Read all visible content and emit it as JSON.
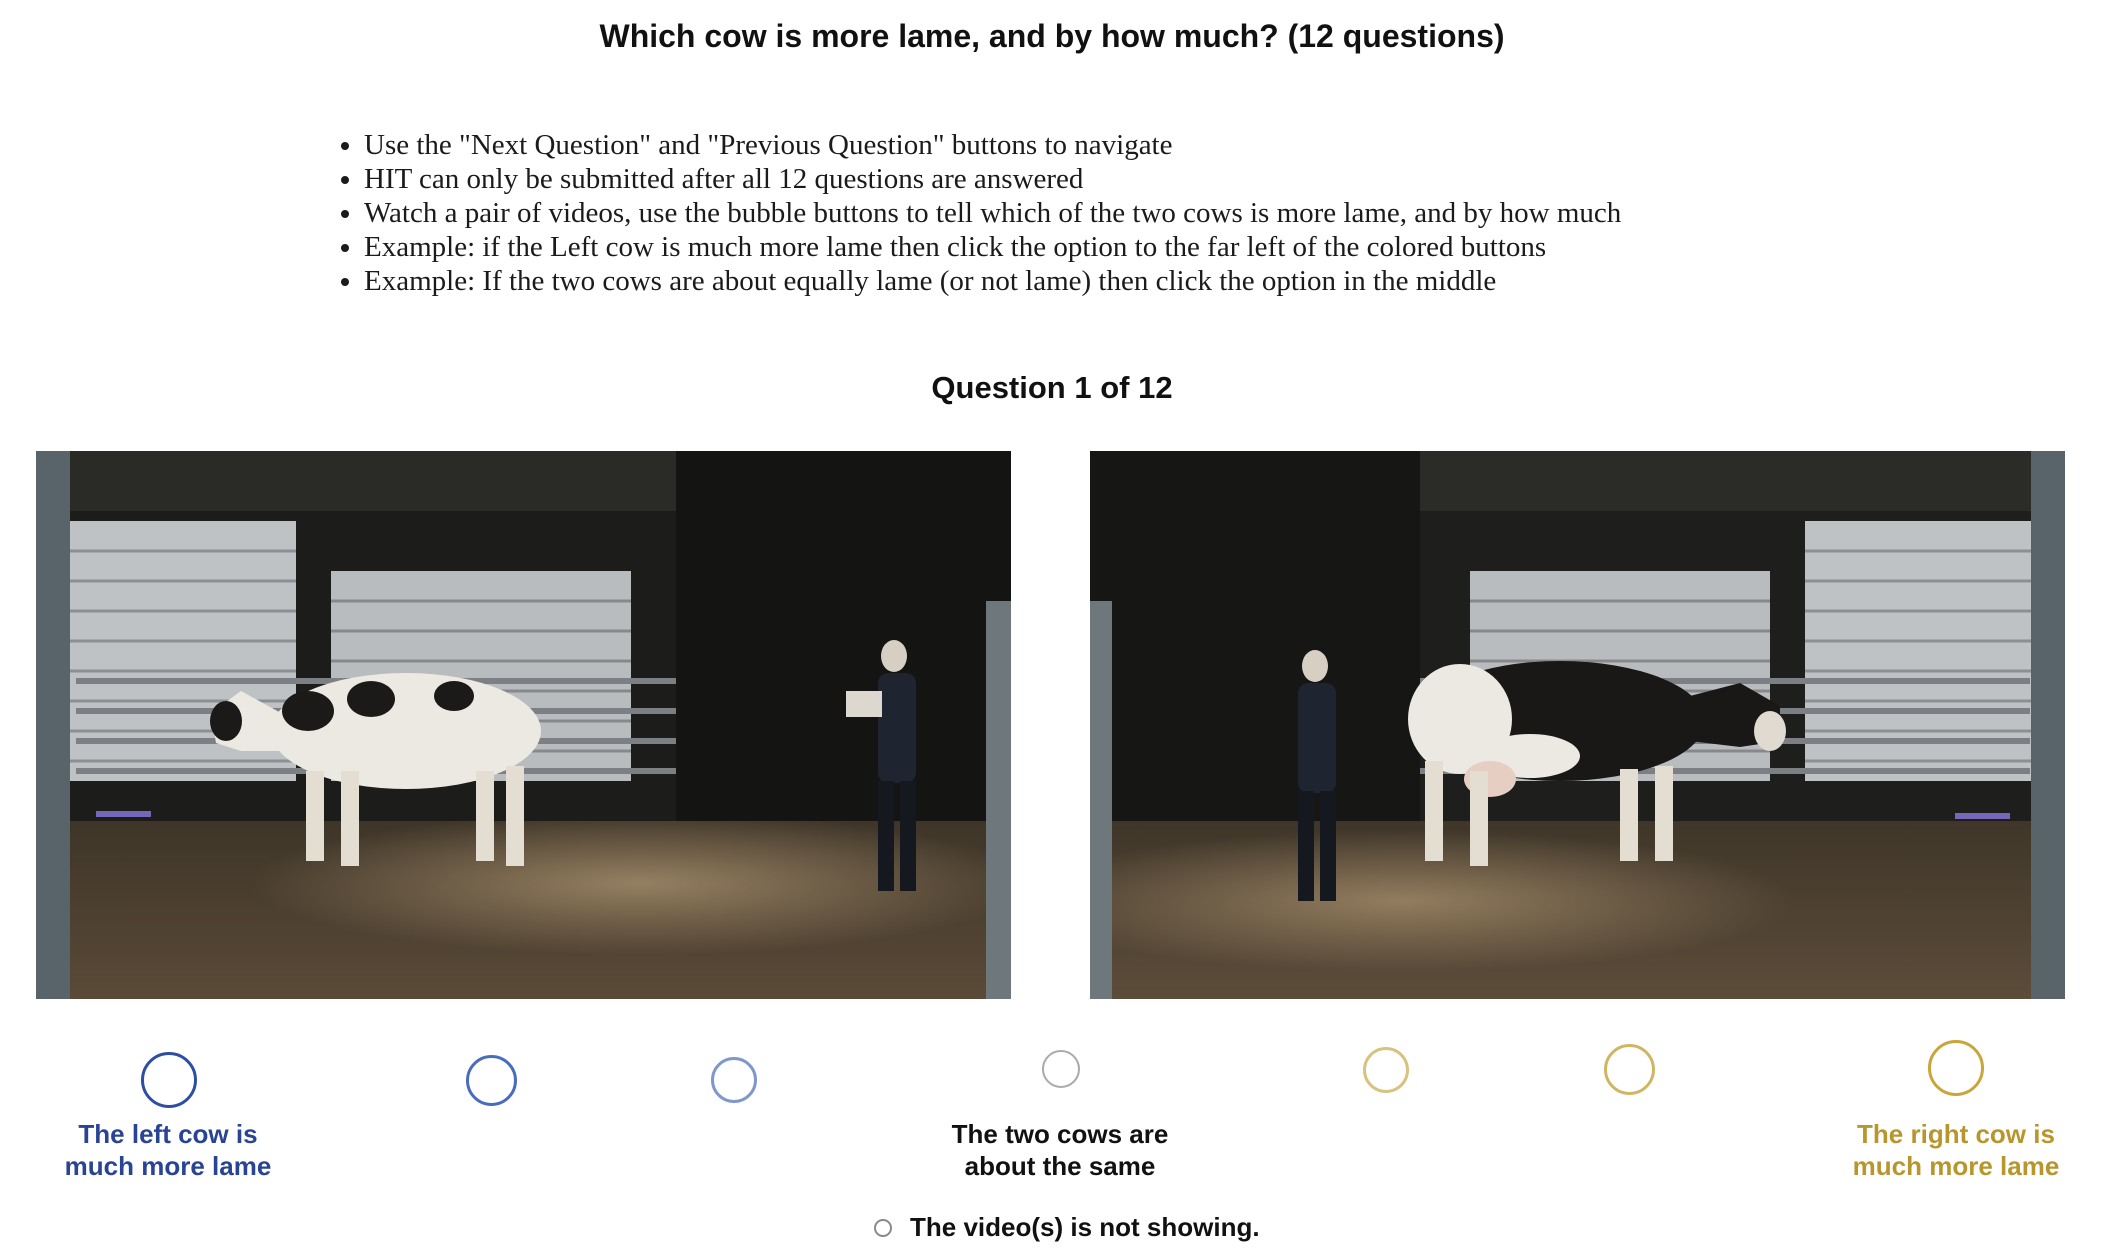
{
  "title": "Which cow is more lame, and by how much? (12 questions)",
  "instructions": [
    "Use the \"Next Question\" and \"Previous Question\" buttons to navigate",
    "HIT can only be submitted after all 12 questions are answered",
    "Watch a pair of videos, use the bubble buttons to tell which of the two cows is more lame, and by how much",
    "Example: if the Left cow is much more lame then click the option to the far left of the colored buttons",
    "Example: If the two cows are about equally lame (or not lame) then click the option in the middle"
  ],
  "question": {
    "heading": "Question 1 of 12",
    "current": 1,
    "total": 12
  },
  "scale": {
    "left_label": [
      "The left cow is",
      "much more lame"
    ],
    "middle_label": [
      "The two cows are",
      "about the same"
    ],
    "right_label": [
      "The right cow is",
      "much more lame"
    ],
    "colors": {
      "left": "#2d4ea3",
      "middle": "#aaaaaa",
      "right": "#c8a63a",
      "left_text": "#2a4494",
      "right_text": "#b8962e"
    }
  },
  "not_showing_label": "The video(s) is not showing."
}
